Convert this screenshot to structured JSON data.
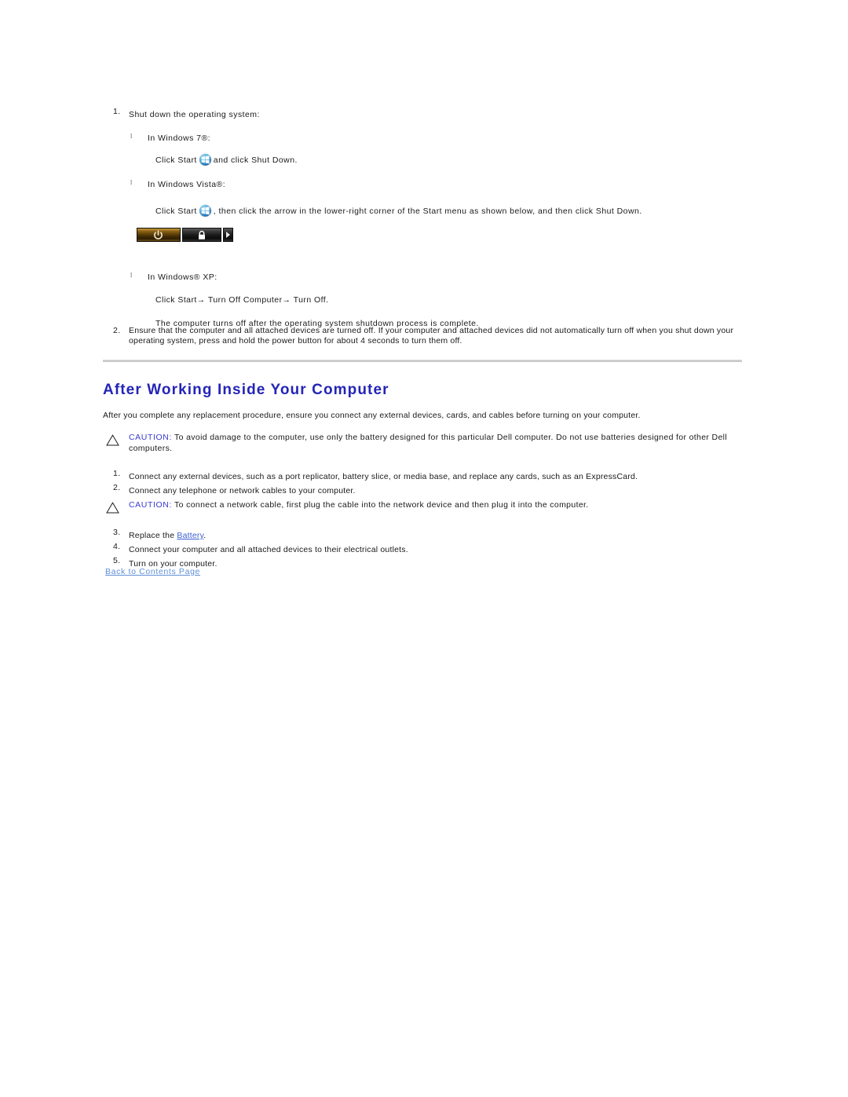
{
  "document": {
    "shutdown_steps": [
      {
        "number": "1.",
        "text": "Shut down the operating system:",
        "sub_items": [
          {
            "marker": "l",
            "label_prefix": "In Windows 7",
            "trademark": "®",
            "label_suffix": ":",
            "icon": "windows-orb-icon",
            "body_before": "Click Start",
            "body_after": "and click Shut Down."
          },
          {
            "marker": "l",
            "label_prefix": "In Windows Vista",
            "trademark": "®",
            "label_suffix": ":",
            "icon": "windows-orb-icon",
            "body_before": "Click Start",
            "body_after": ", then click the arrow in the lower-right corner of the Start menu as shown below, and then click Shut Down."
          },
          {
            "marker": "l",
            "label_prefix": "In Windows",
            "trademark": "®",
            "label_suffix": " XP:",
            "body_line_1": "Click Start→ Turn Off Computer→ Turn Off.",
            "body_line_2": "The computer turns off after the operating system shutdown process is complete."
          }
        ]
      },
      {
        "number": "2.",
        "text": "Ensure that the computer and all attached devices are turned off. If your computer and attached devices did not automatically turn off when you shut down your operating system, press and hold the power button for about 4 seconds to turn them off."
      }
    ],
    "vista_image": {
      "alt": "Windows Vista Start menu shutdown button strip",
      "buttons": [
        {
          "name": "power-button",
          "icon": "power-icon",
          "color": "#8a6114"
        },
        {
          "name": "lock-button",
          "icon": "lock-icon",
          "color": "#2b2b2b"
        },
        {
          "name": "arrow-button",
          "icon": "triangle-right-icon",
          "color": "#2b2b2b"
        }
      ]
    },
    "section": {
      "heading": "After Working Inside Your Computer",
      "intro": "After you complete any replacement procedure, ensure you connect any external devices, cards, and cables before turning on your computer.",
      "caution_1": {
        "label": "CAUTION:",
        "text": " To avoid damage to the computer, use only the battery designed for this particular Dell computer. Do not use batteries designed for other Dell computers."
      },
      "steps_a": [
        {
          "number": "1.",
          "text": "Connect any external devices, such as a port replicator, battery slice, or media base, and replace any cards, such as an ExpressCard."
        },
        {
          "number": "2.",
          "text": "Connect any telephone or network cables to your computer."
        }
      ],
      "caution_2": {
        "label": "CAUTION:",
        "text": " To connect a network cable, first plug the cable into the network device and then plug it into the computer."
      },
      "steps_b": [
        {
          "number": "3.",
          "text_before": "Replace the ",
          "link": "Battery",
          "text_after": "."
        },
        {
          "number": "4.",
          "text": "Connect your computer and all attached devices to their electrical outlets."
        },
        {
          "number": "5.",
          "text": "Turn on your computer."
        }
      ]
    },
    "footer": {
      "back_link": "Back to Contents Page"
    },
    "colors": {
      "heading_blue": "#2424b8",
      "caution_blue": "#3b3bd0",
      "link_blue": "#3b5fd0",
      "footer_link_blue": "#5f8fd8",
      "rule_gray": "#c8c8c8"
    }
  }
}
